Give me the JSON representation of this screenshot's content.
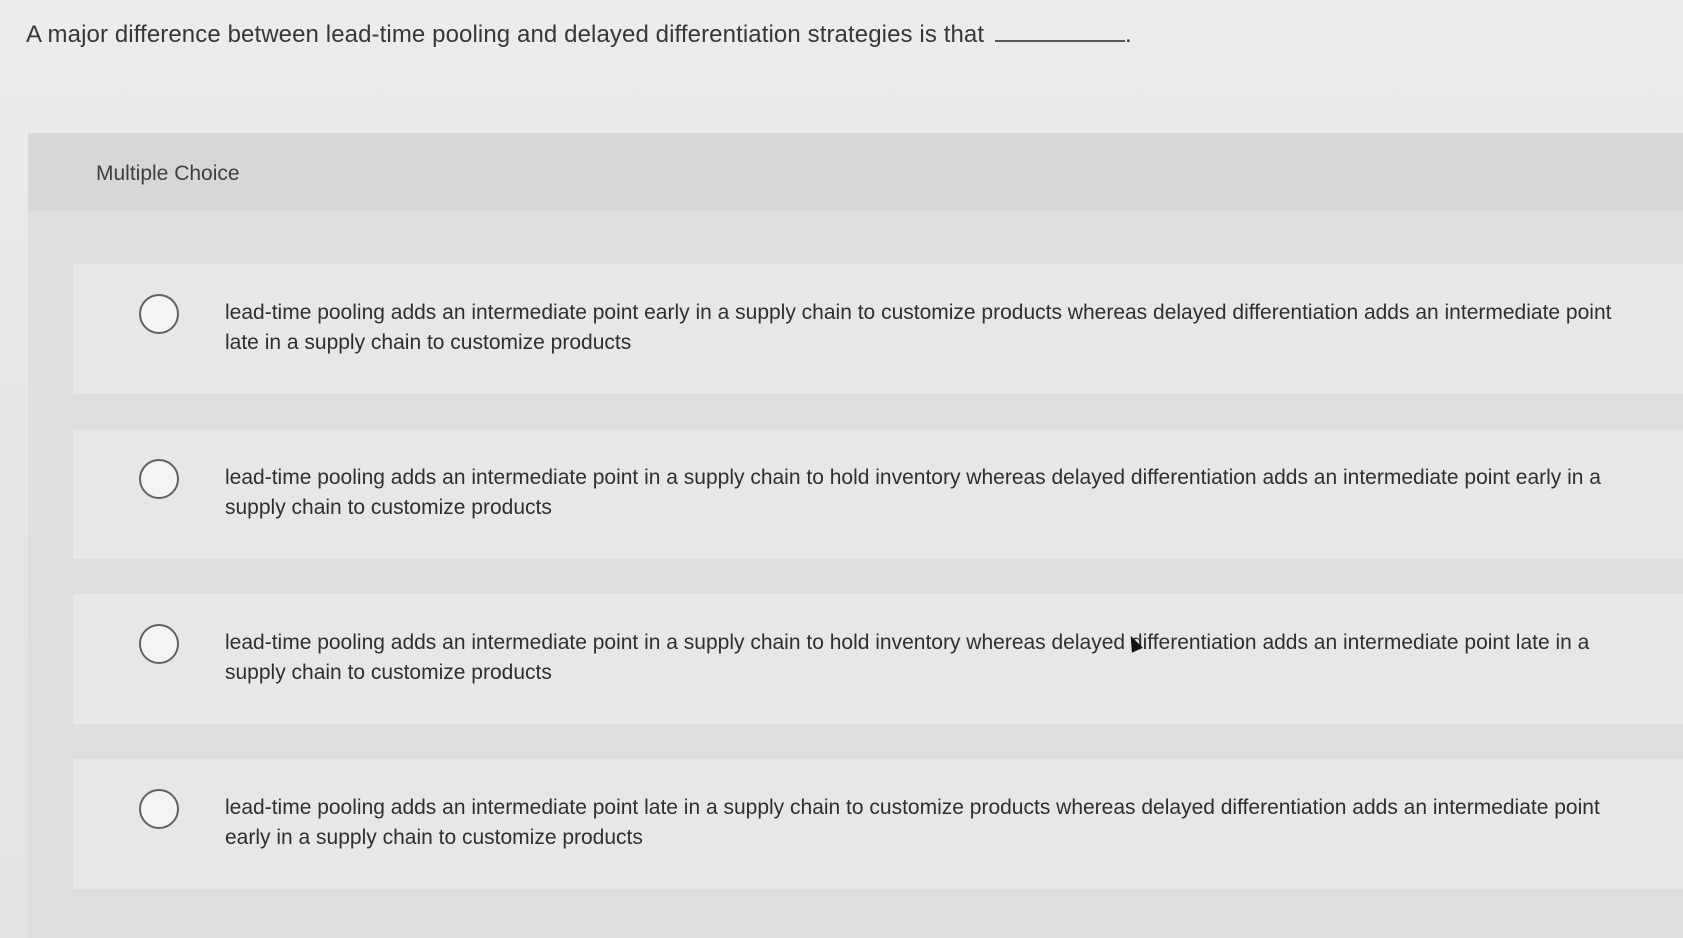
{
  "question": {
    "text": "A major difference between lead-time pooling and delayed differentiation strategies is that",
    "end_punctuation": "."
  },
  "section": {
    "title": "Multiple Choice"
  },
  "options": [
    {
      "label": "lead-time pooling adds an intermediate point early in a supply chain to customize products whereas delayed differentiation adds an intermediate point late in a supply chain to customize products"
    },
    {
      "label": "lead-time pooling adds an intermediate point in a supply chain to hold inventory whereas delayed differentiation adds an intermediate point early in a supply chain to customize products"
    },
    {
      "label": "lead-time pooling adds an intermediate point in a supply chain to hold inventory whereas delayed differentiation adds an intermediate point late in a supply chain to customize products"
    },
    {
      "label": "lead-time pooling adds an intermediate point late in a supply chain to customize products whereas delayed differentiation adds an intermediate point early in a supply chain to customize products"
    }
  ]
}
